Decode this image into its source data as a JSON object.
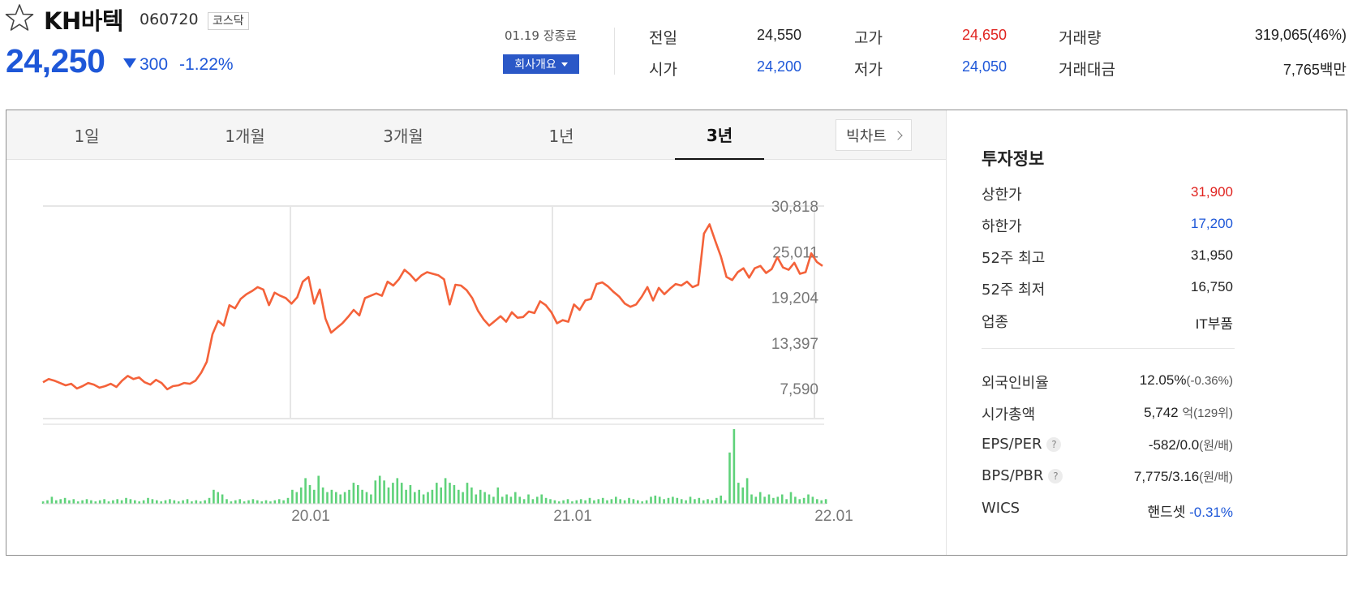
{
  "stock": {
    "name": "KH바텍",
    "code": "060720",
    "market": "코스닥",
    "price": "24,250",
    "change": "300",
    "change_rate": "-1.22%",
    "direction": "down"
  },
  "session": {
    "close_label": "01.19 장종료",
    "company_button": "회사개요"
  },
  "quote": {
    "prev_label": "전일",
    "prev_value": "24,550",
    "open_label": "시가",
    "open_value": "24,200",
    "high_label": "고가",
    "high_value": "24,650",
    "low_label": "저가",
    "low_value": "24,050",
    "volume_label": "거래량",
    "volume_value": "319,065(46%)",
    "amount_label": "거래대금",
    "amount_value": "7,765",
    "amount_unit": "백만"
  },
  "tabs": [
    "1일",
    "1개월",
    "3개월",
    "1년",
    "3년"
  ],
  "active_tab": "3년",
  "bigchart_label": "빅차트",
  "chart_data": {
    "type": "line",
    "series": [
      {
        "values": [
          8400,
          8800,
          8600,
          8300,
          8000,
          8200,
          7600,
          7900,
          8300,
          8100,
          7700,
          7900,
          8200,
          7800,
          8600,
          9200,
          8800,
          9000,
          8400,
          8100,
          8700,
          8300,
          7500,
          7900,
          8000,
          8300,
          8200,
          8600,
          9600,
          11000,
          14500,
          16200,
          15600,
          18200,
          17800,
          19000,
          19600,
          20000,
          20500,
          20200,
          18200,
          19800,
          19400,
          19100,
          18400,
          19200,
          21200,
          21800,
          18400,
          20200,
          16500,
          14700,
          15300,
          15900,
          16700,
          17600,
          16900,
          19100,
          19400,
          19700,
          19400,
          21200,
          20700,
          21500,
          22700,
          22100,
          21300,
          22000,
          22400,
          22200,
          22000,
          21500,
          18300,
          20800,
          20700,
          20100,
          19100,
          17500,
          16400,
          15600,
          16200,
          16800,
          16100,
          17300,
          16600,
          16700,
          17400,
          17200,
          18700,
          18200,
          17300,
          15900,
          16300,
          16100,
          18300,
          17600,
          18800,
          19000,
          20900,
          21100,
          20600,
          19900,
          19300,
          18400,
          18000,
          18300,
          19300,
          20500,
          18800,
          20400,
          19600,
          20300,
          20900,
          20700,
          21200,
          20500,
          20800,
          27300,
          28500,
          26400,
          24400,
          21800,
          21400,
          22400,
          22900,
          21700,
          22900,
          23200,
          22300,
          22800,
          24300,
          23000,
          22700,
          23600,
          22200,
          22400,
          24800,
          23700,
          23200
        ]
      }
    ],
    "volume": [
      2,
      3,
      6,
      3,
      4,
      5,
      3,
      4,
      2,
      3,
      4,
      3,
      2,
      3,
      4,
      2,
      3,
      4,
      3,
      5,
      4,
      3,
      2,
      3,
      5,
      4,
      3,
      2,
      3,
      4,
      3,
      2,
      3,
      4,
      2,
      3,
      2,
      3,
      5,
      12,
      10,
      8,
      4,
      2,
      3,
      4,
      2,
      3,
      4,
      3,
      2,
      3,
      2,
      3,
      4,
      3,
      5,
      12,
      10,
      14,
      22,
      16,
      12,
      24,
      14,
      10,
      12,
      10,
      8,
      10,
      12,
      18,
      16,
      12,
      10,
      8,
      20,
      24,
      20,
      14,
      18,
      22,
      18,
      12,
      16,
      10,
      12,
      8,
      10,
      12,
      18,
      14,
      22,
      18,
      16,
      12,
      10,
      18,
      14,
      8,
      12,
      10,
      8,
      6,
      14,
      6,
      8,
      6,
      10,
      6,
      4,
      8,
      4,
      6,
      8,
      5,
      4,
      3,
      2,
      3,
      4,
      2,
      3,
      4,
      3,
      5,
      3,
      4,
      5,
      3,
      4,
      6,
      4,
      3,
      5,
      4,
      3,
      2,
      3,
      6,
      7,
      6,
      4,
      5,
      6,
      5,
      4,
      3,
      6,
      4,
      5,
      3,
      4,
      3,
      5,
      7,
      3,
      44,
      64,
      18,
      14,
      22,
      8,
      6,
      10,
      6,
      8,
      5,
      6,
      8,
      4,
      10,
      6,
      4,
      5,
      8,
      6,
      4,
      3,
      4
    ],
    "ylim": [
      7590,
      30818
    ],
    "y_ticks": [
      "30,818",
      "25,011",
      "19,204",
      "13,397",
      "7,590"
    ],
    "x_ticks": [
      "20.01",
      "21.01",
      "22.01"
    ],
    "grid": true,
    "line_color": "#f4623a",
    "volume_color": "#5fd27a"
  },
  "invest": {
    "title": "투자정보",
    "upper_label": "상한가",
    "upper_value": "31,900",
    "lower_label": "하한가",
    "lower_value": "17,200",
    "w52_high_label": "52주 최고",
    "w52_high_value": "31,950",
    "w52_low_label": "52주 최저",
    "w52_low_value": "16,750",
    "sector_label": "업종",
    "sector_value": "IT부품",
    "foreign_label": "외국인비율",
    "foreign_value": "12.05%",
    "foreign_change": "(-0.36%)",
    "mcap_label": "시가총액",
    "mcap_value": "5,742",
    "mcap_unit": "억",
    "mcap_rank": "(129위)",
    "eps_label": "EPS/PER",
    "eps_value": "-582/0.0",
    "eps_unit": "(원/배)",
    "bps_label": "BPS/PBR",
    "bps_value": "7,775/3.16",
    "bps_unit": "(원/배)",
    "wics_label": "WICS",
    "wics_value": "핸드셋",
    "wics_change": "-0.31%"
  },
  "colors": {
    "up": "#e0231f",
    "down": "#1e57d8",
    "button": "#2b58c7"
  }
}
